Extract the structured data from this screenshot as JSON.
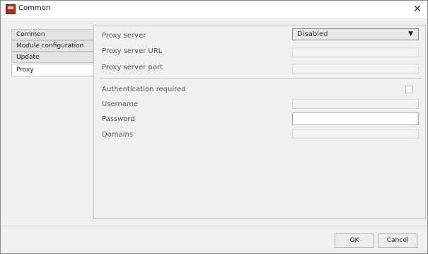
{
  "window": {
    "title": "Common",
    "icon": "app-icon",
    "close_glyph": "✕"
  },
  "tabs": [
    {
      "label": "Common",
      "active": false
    },
    {
      "label": "Module configuration",
      "active": false
    },
    {
      "label": "Update",
      "active": false
    },
    {
      "label": "Proxy",
      "active": true
    }
  ],
  "proxy": {
    "proxy_server_label": "Proxy server",
    "proxy_server_value": "Disabled",
    "dropdown_arrow": "▼",
    "proxy_url_label": "Proxy server URL",
    "proxy_url_value": "",
    "proxy_port_label": "Proxy server port",
    "proxy_port_value": "",
    "auth_label": "Authentication required",
    "auth_checked": false,
    "username_label": "Username",
    "username_value": "",
    "password_label": "Password",
    "password_value": "",
    "domains_label": "Domains",
    "domains_value": ""
  },
  "buttons": {
    "ok": "OK",
    "cancel": "Cancel"
  }
}
